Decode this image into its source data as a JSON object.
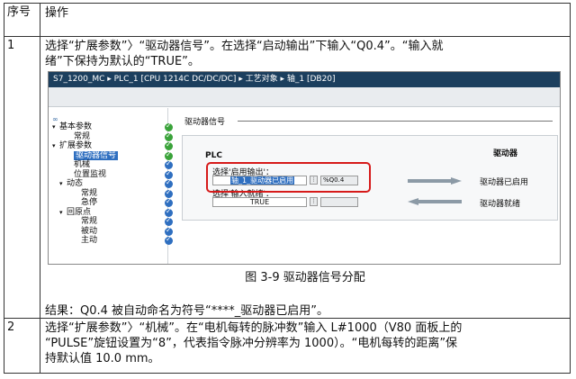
{
  "table": {
    "head_num": "序号",
    "head_op": "操作"
  },
  "step1": {
    "num": "1",
    "line1": "选择“扩展参数”〉“驱动器信号”。在选择“启动输出”下输入“Q0.4”。“输入就",
    "line2": "绪”下保持为默认的“TRUE”。",
    "caption": "图 3-9   驱动器信号分配",
    "result": "结果：Q0.4 被自动命名为符号“****_驱动器已启用”。"
  },
  "screenshot": {
    "breadcrumb": "S7_1200_MC ▸ PLC_1 [CPU 1214C DC/DC/DC] ▸ 工艺对象 ▸ 轴_1 [DB20]",
    "tree": [
      {
        "label": "基本参数",
        "indent": 0,
        "expand": "▾",
        "status": "ok"
      },
      {
        "label": "常规",
        "indent": 2,
        "expand": "",
        "status": "ok"
      },
      {
        "label": "扩展参数",
        "indent": 0,
        "expand": "▾",
        "status": "ok"
      },
      {
        "label": "驱动器信号",
        "indent": 2,
        "expand": "",
        "status": "ok",
        "selected": true
      },
      {
        "label": "机械",
        "indent": 2,
        "expand": "",
        "status": "blue"
      },
      {
        "label": "位置监视",
        "indent": 2,
        "expand": "",
        "status": "blue"
      },
      {
        "label": "动态",
        "indent": 1,
        "expand": "▾",
        "status": "blue"
      },
      {
        "label": "常规",
        "indent": 3,
        "expand": "",
        "status": "blue"
      },
      {
        "label": "急停",
        "indent": 3,
        "expand": "",
        "status": "blue"
      },
      {
        "label": "回原点",
        "indent": 1,
        "expand": "▾",
        "status": "blue"
      },
      {
        "label": "常规",
        "indent": 3,
        "expand": "",
        "status": "blue"
      },
      {
        "label": "被动",
        "indent": 3,
        "expand": "",
        "status": "blue"
      },
      {
        "label": "主动",
        "indent": 3,
        "expand": "",
        "status": "blue"
      }
    ],
    "section_title": "驱动器信号",
    "plc_label": "PLC",
    "drive_label": "驱动器",
    "enable_label": "选择'启用输出'：",
    "enable_value": "轴_1_驱动器已启用",
    "enable_address": "%Q0.4",
    "ready_label": "选择'输入就绪'：",
    "ready_value": "TRUE",
    "drive_enabled": "驱动器已启用",
    "drive_ready": "驱动器就绪"
  },
  "step2": {
    "num": "2",
    "line1": "选择“扩展参数”〉“机械”。在“电机每转的脉冲数”输入 L#1000（V80 面板上的",
    "line2": "“PULSE”旋钮设置为“8”，代表指令脉冲分辨率为 1000）。“电机每转的距离”保",
    "line3": "持默认值 10.0 mm。"
  },
  "colors": {
    "title_bar": "#1c3f5e",
    "highlight": "#d61a1a",
    "status_ok": "#3aa33a",
    "status_blue": "#2f6fc0"
  }
}
